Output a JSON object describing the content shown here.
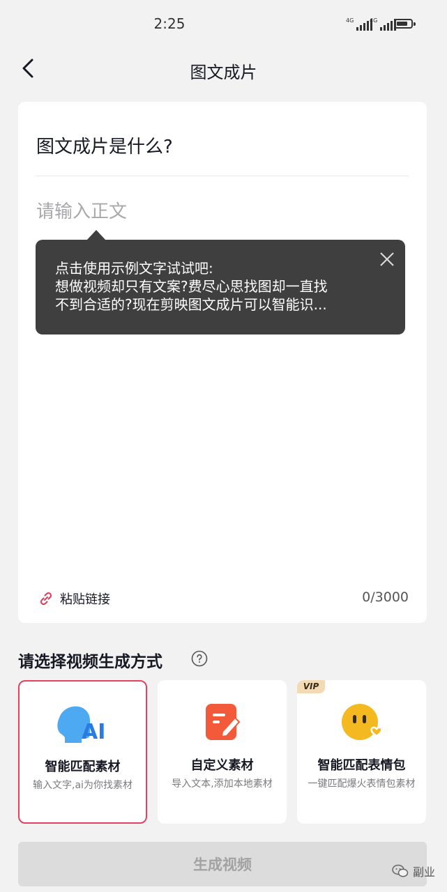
{
  "status_bar": {
    "time": "2:25",
    "signal_1_label": "4G",
    "signal_2_label": "4G"
  },
  "nav": {
    "title": "图文成片"
  },
  "editor": {
    "title": "图文成片是什么?",
    "body_placeholder": "请输入正文",
    "body_value": "",
    "tooltip": {
      "line1": "点击使用示例文字试试吧:",
      "line2": "想做视频却只有文案?费尽心思找图却一直找",
      "line3": "不到合适的?现在剪映图文成片可以智能识..."
    },
    "paste_link_label": "粘贴链接",
    "char_count": "0/3000"
  },
  "section": {
    "title": "请选择视频生成方式"
  },
  "options": [
    {
      "title": "智能匹配素材",
      "desc": "输入文字,ai为你找素材",
      "icon_text": "AI",
      "selected": true
    },
    {
      "title": "自定义素材",
      "desc": "导入文本,添加本地素材",
      "selected": false
    },
    {
      "title": "智能匹配表情包",
      "desc": "一键匹配爆火表情包素材",
      "badge": "VIP",
      "selected": false
    }
  ],
  "generate_button_label": "生成视频",
  "watermark_label": "副业",
  "colors": {
    "accent": "#e0425f",
    "tooltip_bg": "#3f3f3f",
    "ai_blue": "#3aa0f0",
    "edit_orange": "#f35a3a",
    "emoji_yellow": "#f4b820",
    "button_disabled": "#dcdcdc"
  }
}
